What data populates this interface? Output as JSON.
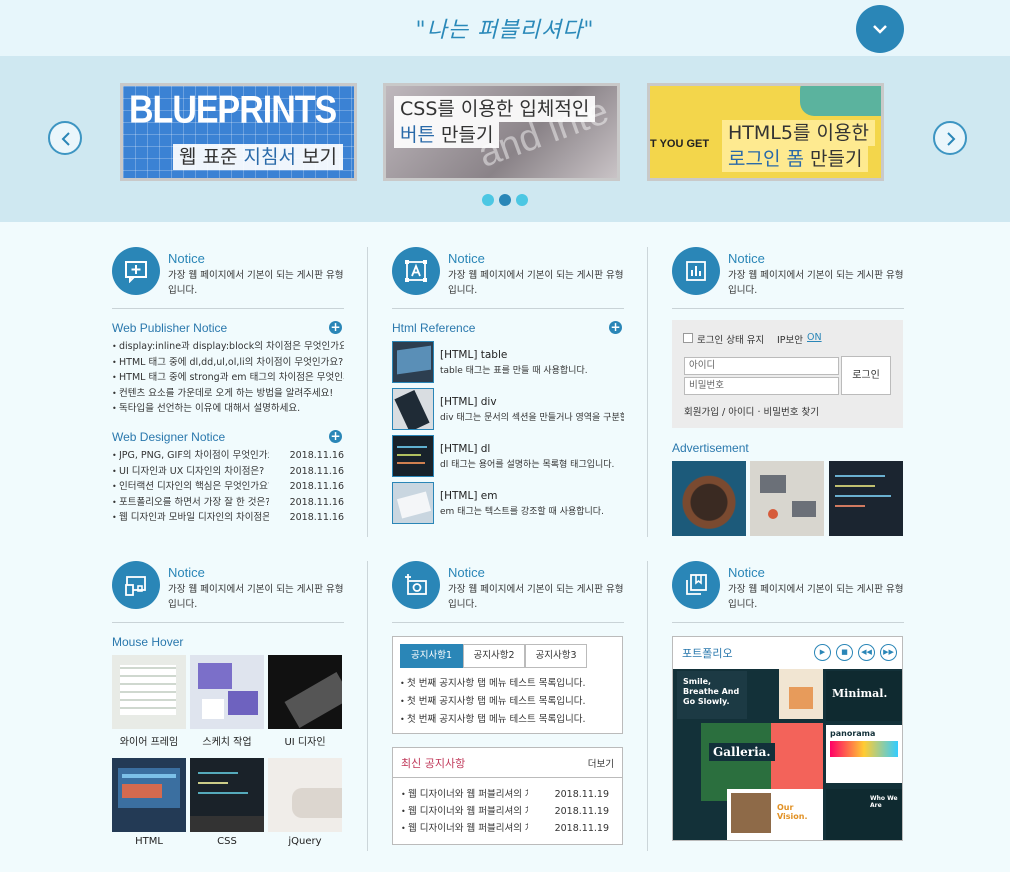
{
  "header": {
    "title": "\"나는 퍼블리셔다\""
  },
  "slides": [
    {
      "line1": "BLUEPRINTS",
      "cap_a": "웹 표준 ",
      "cap_b": "지침서",
      "cap_c": " 보기"
    },
    {
      "line1": "CSS를 이용한 입체적인",
      "cap_b": "버튼",
      "cap_c": " 만들기"
    },
    {
      "line1": "HTML5를 이용한",
      "cap_b": "로그인 폼",
      "cap_c": " 만들기",
      "tag": "T YOU GET"
    }
  ],
  "notice_title": "Notice",
  "notice_desc": "가장 웹 페이지에서 기본이 되는 게시판 유형입니다.",
  "pub": {
    "title": "Web Publisher Notice",
    "items": [
      "display:inline과 display:block의 차이점은 무엇인가요?",
      "HTML 태그 중에 dl,dd,ul,ol,li의 차이점이 무엇인가요?",
      "HTML 태그 중에 strong과 em 태그의 차이점은 무엇인가요?",
      "컨텐츠 요소를 가운데로 오게 하는 방법을 알려주세요!",
      "독타입을 선언하는 이유에 대해서 설명하세요."
    ]
  },
  "des": {
    "title": "Web Designer Notice",
    "items": [
      {
        "t": "JPG, PNG, GIF의 차이점이 무엇인가요?",
        "d": "2018.11.16"
      },
      {
        "t": "UI 디자인과 UX 디자인의 차이점은?",
        "d": "2018.11.16"
      },
      {
        "t": "인터랙션 디자인의 핵심은 무엇인가요?",
        "d": "2018.11.16"
      },
      {
        "t": "포트폴리오를 하면서 가장 잘 한 것은?",
        "d": "2018.11.16"
      },
      {
        "t": "웹 디자인과 모바일 디자인의 차이점은?",
        "d": "2018.11.16"
      }
    ]
  },
  "html_ref": {
    "title": "Html Reference",
    "items": [
      {
        "t": "[HTML] table",
        "d": "table 태그는 표를 만들 때 사용합니다."
      },
      {
        "t": "[HTML] div",
        "d": "div 태그는 문서의 섹션을 만들거나 영역을 구분할 때 사용합니다."
      },
      {
        "t": "[HTML] dl",
        "d": "dl 태그는 용어를 설명하는 목록형 태그입니다."
      },
      {
        "t": "[HTML] em",
        "d": "em 태그는 텍스트를 강조할 때 사용합니다."
      }
    ]
  },
  "login": {
    "keep": "로그인 상태 유지",
    "ip": "IP보안",
    "on": "ON",
    "id_ph": "아이디",
    "pw_ph": "비밀번호",
    "btn": "로그인",
    "links": "회원가입 / 아이디 · 비밀번호 찾기"
  },
  "ad_title": "Advertisement",
  "hover": {
    "title": "Mouse Hover",
    "items": [
      "와이어 프레임",
      "스케치 작업",
      "UI 디자인",
      "HTML",
      "CSS",
      "jQuery"
    ]
  },
  "tabs": {
    "labels": [
      "공지사항1",
      "공지사항2",
      "공지사항3"
    ],
    "items": [
      "첫 번째 공지사항 탭 메뉴 테스트 목록입니다.",
      "첫 번째 공지사항 탭 메뉴 테스트 목록입니다.",
      "첫 번째 공지사항 탭 메뉴 테스트 목록입니다."
    ]
  },
  "news": {
    "title": "최신 공지사항",
    "more": "더보기",
    "items": [
      {
        "t": "웹 디자이너와 웹 퍼블리셔의 차이",
        "d": "2018.11.19"
      },
      {
        "t": "웹 디자이너와 웹 퍼블리셔의 차이",
        "d": "2018.11.19"
      },
      {
        "t": "웹 디자이너와 웹 퍼블리셔의 차이",
        "d": "2018.11.19"
      }
    ]
  },
  "portfolio": {
    "title": "포트폴리오",
    "controls": [
      "▶",
      "■",
      "◀◀",
      "▶▶"
    ],
    "cards": [
      "Smile, Breathe And Go Slowly.",
      "Minimal.",
      "Galleria.",
      "panorama",
      "Our Vision.",
      "Who We Are"
    ]
  }
}
